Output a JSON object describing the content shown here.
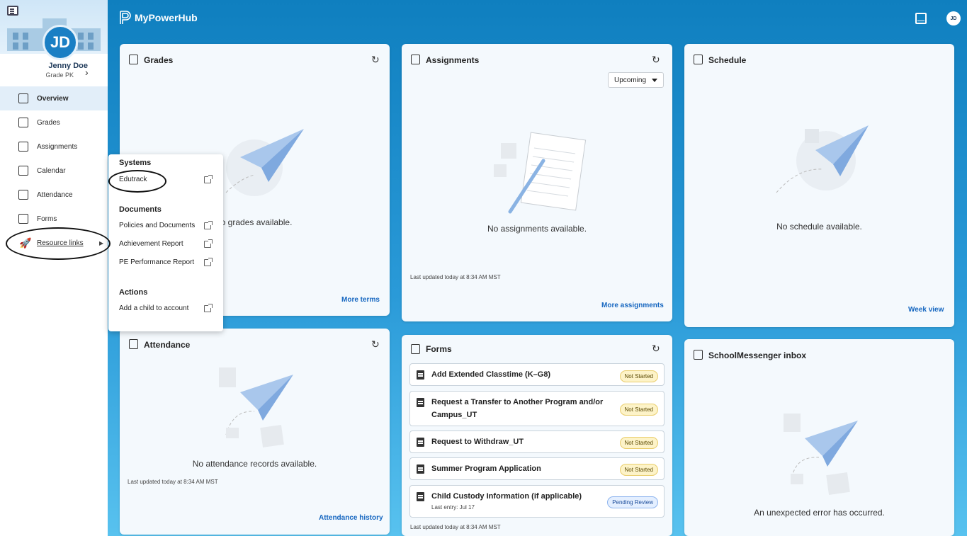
{
  "sidebar": {
    "initials": "JD",
    "student_name": "Jenny Doe",
    "student_grade": "Grade PK",
    "items": [
      {
        "label": "Overview",
        "icon": "overview-icon"
      },
      {
        "label": "Grades",
        "icon": "grades-icon"
      },
      {
        "label": "Assignments",
        "icon": "assignments-icon"
      },
      {
        "label": "Calendar",
        "icon": "calendar-icon"
      },
      {
        "label": "Attendance",
        "icon": "attendance-icon"
      },
      {
        "label": "Forms",
        "icon": "forms-icon"
      },
      {
        "label": "Resource links",
        "icon": "rocket-icon"
      }
    ]
  },
  "header": {
    "app_title": "MyPowerHub",
    "user_initials": "JD"
  },
  "flyout": {
    "systems_heading": "Systems",
    "systems_items": [
      "Edutrack"
    ],
    "documents_heading": "Documents",
    "documents_items": [
      "Policies and Documents",
      "Achievement Report",
      "PE Performance Report"
    ],
    "actions_heading": "Actions",
    "actions_items": [
      "Add a child to account"
    ]
  },
  "grades": {
    "title": "Grades",
    "empty": "lo grades available.",
    "link": "More terms"
  },
  "assignments": {
    "title": "Assignments",
    "filter_value": "Upcoming",
    "empty": "No assignments available.",
    "updated": "Last updated today at 8:34 AM MST",
    "link": "More assignments"
  },
  "schedule": {
    "title": "Schedule",
    "empty": "No schedule available.",
    "link": "Week view"
  },
  "attendance": {
    "title": "Attendance",
    "empty": "No attendance records available.",
    "updated": "Last updated today at 8:34 AM MST",
    "link": "Attendance history"
  },
  "forms": {
    "title": "Forms",
    "rows": [
      {
        "label": "Add Extended Classtime (K–G8)",
        "status": "Not Started"
      },
      {
        "label": "Request a Transfer to Another Program and/or",
        "label2": "Campus_UT",
        "status": "Not Started"
      },
      {
        "label": "Request to Withdraw_UT",
        "status": "Not Started"
      },
      {
        "label": "Summer Program Application",
        "status": "Not Started"
      },
      {
        "label": "Child Custody Information (if applicable)",
        "sub": "Last entry: Jul 17",
        "status": "Pending Review"
      }
    ],
    "updated": "Last updated today at 8:34 AM MST"
  },
  "messenger": {
    "title": "SchoolMessenger inbox",
    "error": "An unexpected error has occurred."
  },
  "colors": {
    "header_blue": "#0f7fbf",
    "link_blue": "#1566c0",
    "avatar_blue": "#1a7fc4"
  }
}
